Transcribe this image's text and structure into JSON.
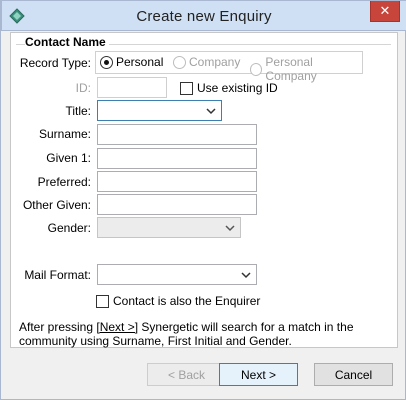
{
  "window": {
    "title": "Create new Enquiry",
    "close_label": "✕"
  },
  "group": {
    "title": "Contact Name"
  },
  "record_type": {
    "label": "Record Type:",
    "options": [
      {
        "label": "Personal",
        "selected": true,
        "disabled": false
      },
      {
        "label": "Company",
        "selected": false,
        "disabled": true
      },
      {
        "label": "Personal Company",
        "selected": false,
        "disabled": true
      }
    ]
  },
  "id_field": {
    "label": "ID:",
    "value": "",
    "checkbox_label": "Use existing ID"
  },
  "title_field": {
    "label": "Title:",
    "value": ""
  },
  "surname": {
    "label": "Surname:",
    "value": ""
  },
  "given1": {
    "label": "Given 1:",
    "value": ""
  },
  "preferred": {
    "label": "Preferred:",
    "value": ""
  },
  "other_given": {
    "label": "Other Given:",
    "value": ""
  },
  "gender": {
    "label": "Gender:",
    "value": ""
  },
  "mail_format": {
    "label": "Mail Format:",
    "value": ""
  },
  "enquirer_check": {
    "label": "Contact is also the Enquirer"
  },
  "info": {
    "before": "After pressing ",
    "link": "[Next >]",
    "after": " Synergetic will search for a match in the community using Surname, First Initial and Gender."
  },
  "buttons": {
    "back": "< Back",
    "next": "Next >",
    "cancel": "Cancel"
  }
}
